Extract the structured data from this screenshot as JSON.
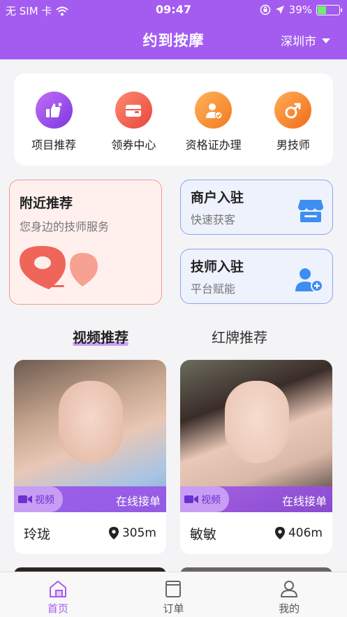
{
  "status_bar": {
    "carrier": "无 SIM 卡",
    "time": "09:47",
    "battery": "39%",
    "battery_level": 0.39
  },
  "header": {
    "title": "约到按摩",
    "city": "深圳市"
  },
  "quick_menu": [
    {
      "label": "项目推荐",
      "icon": "thumbs-up-icon",
      "color": "#9a4ff0"
    },
    {
      "label": "领券中心",
      "icon": "wallet-icon",
      "color": "#f05a48"
    },
    {
      "label": "资格证办理",
      "icon": "certificate-icon",
      "color": "#f58a2a"
    },
    {
      "label": "男技师",
      "icon": "male-icon",
      "color": "#f47a22"
    }
  ],
  "cards": {
    "nearby": {
      "title": "附近推荐",
      "subtitle": "您身边的技师服务"
    },
    "merchant": {
      "title": "商户入驻",
      "subtitle": "快速获客"
    },
    "technician": {
      "title": "技师入驻",
      "subtitle": "平台赋能"
    }
  },
  "tabs": {
    "active": "视频推荐",
    "inactive": "红牌推荐"
  },
  "videos": [
    {
      "name": "玲珑",
      "distance": "305m",
      "tag": "视频",
      "status": "在线接单"
    },
    {
      "name": "敏敏",
      "distance": "406m",
      "tag": "视频",
      "status": "在线接单"
    }
  ],
  "bottom_nav": [
    {
      "label": "首页",
      "icon": "home-icon"
    },
    {
      "label": "订单",
      "icon": "order-icon"
    },
    {
      "label": "我的",
      "icon": "profile-icon"
    }
  ],
  "colors": {
    "primary": "#a45cf0",
    "nearby_border": "#f09b90",
    "side_border": "#8fa4f0"
  }
}
